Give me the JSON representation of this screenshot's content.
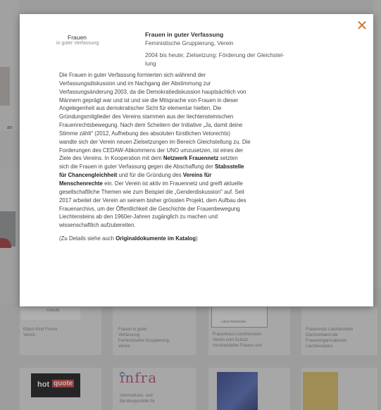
{
  "modal": {
    "close_glyph": "✕",
    "logo_word1": "Frauen",
    "logo_word2": "in guter Verfassung",
    "name": "Frauen in guter Verfassung",
    "type": "Feministische Gruppierung, Verein",
    "since_line1": "2004 bis heute; Zielsetzung: Förderung der Gleichstel-",
    "since_line2": "lung",
    "body": [
      "Die Frauen in guter Verfassung formierten sich während der",
      "Verfassungsdiskussion und im Nachgang der Abstimmung zur",
      "Verfassungsänderung 2003, da die Demokratiediskussion hauptsächlich von",
      "Männern geprägt war und ist und sie die Mitsprache von Frauen in dieser",
      "Angelegenheit aus demokratischer Sicht für elementar hielten. Die",
      "Gründungsmitglieder des Vereins stammen aus der liechtensteinischen",
      "Frauenrechtsbewegung. Nach dem Scheitern der Initiative „Ja, damit deine",
      "Stimme zählt\" (2012, Aufhebung des absoluten fürstlichen Vetorechts)",
      "wandte sich der Verein neuen Zielsetzungen im Bereich Gleichstellung zu. Die",
      "Forderungen des CEDAW-Abkommens der UNO umzusetzen, ist eines der",
      "Ziele des Vereins. In Kooperation mit dem",
      "Netzwerk Frauennetz",
      "setzten",
      "sich die Frauen in guter Verfassung gegen die Abschaffung der",
      "Stabsstelle",
      "für Chancengleichheit",
      "und für die Gründung des",
      "Vereins für",
      "Menschenrechte",
      "ein. Der Verein ist aktiv im Frauennetz und greift aktuelle",
      "gesellschaftliche Themen wie zum Beispiel die „Genderdiskussion\" auf. Seit",
      "2017 arbeitet der Verein an seinem bisher grössten Projekt, dem Aufbau des",
      "Frauenarchivs, um der Öffentlichkeit die Geschichte der Frauenbewegung",
      "Liechtensteins ab den 1960er-Jahren zugänglich zu machen und",
      "wissenschaftlich aufzubereiten."
    ],
    "details_prefix": "(Zu Details siehe auch",
    "details_link": "Originaldokumente im Katalog",
    "details_suffix": ")"
  },
  "background": {
    "cards_row1": [
      {
        "l1": "Eltern Kind Forum",
        "l2": "Verein",
        "l3": "",
        "l4": ""
      },
      {
        "l1": "Frauen in guter",
        "l2": "Verfassung",
        "l3": "Feministische Gruppierung,",
        "l4": "Verein"
      },
      {
        "l1": "Frauenhaus Liechtenstein",
        "l2": "Verein zum Schutz",
        "l3": "misshandelter Frauen und",
        "l4": ""
      },
      {
        "l1": "Frauennetz Liechtenstein",
        "l2": "Dachverband der",
        "l3": "Frauenorganisationen",
        "l4": "Liechtensteins"
      }
    ],
    "forum_fragment": "FORUM",
    "liechtenstein_fragment": "LIECHTENSTEIN",
    "left_fragment": "an",
    "hotquote_hot": "hot",
    "hotquote_quote": "quote",
    "infra_logo": "infra",
    "infra_l1": "Informations- und",
    "infra_l2": "Beratungsstelle für"
  }
}
